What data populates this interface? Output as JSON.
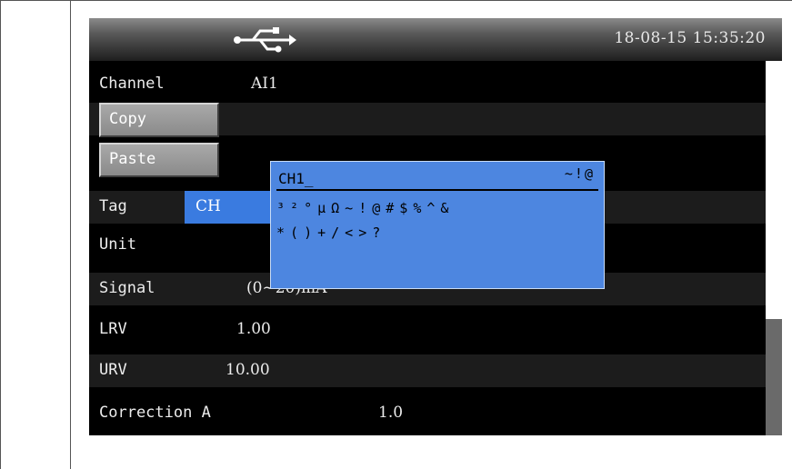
{
  "statusbar": {
    "usb_icon": "usb-icon",
    "datetime": "18-08-15 15:35:20"
  },
  "form": {
    "channel": {
      "label": "Channel",
      "value": "AI1"
    },
    "copy_button": "Copy",
    "paste_button": "Paste",
    "tag": {
      "label": "Tag",
      "value": "CH"
    },
    "unit": {
      "label": "Unit"
    },
    "signal": {
      "label": "Signal",
      "value": "(0~20)mA"
    },
    "lrv": {
      "label": "LRV",
      "value": "1.00"
    },
    "urv": {
      "label": "URV",
      "value": "10.00"
    },
    "correction_a": {
      "label": "Correction A",
      "value": "1.0"
    }
  },
  "keyboard_popup": {
    "input_text": "CH1_",
    "tail_symbols": "~!@",
    "row1": [
      "³",
      "²",
      "°",
      "µ",
      "Ω",
      "~",
      "!",
      "@",
      "#",
      "$",
      "%",
      "^",
      "&"
    ],
    "row2": [
      "*",
      "(",
      ")",
      "+",
      "/",
      "<",
      ">",
      "?"
    ]
  },
  "colors": {
    "accent": "#3a7be0",
    "popup": "#4d86e0",
    "screen_bg": "#000000"
  }
}
